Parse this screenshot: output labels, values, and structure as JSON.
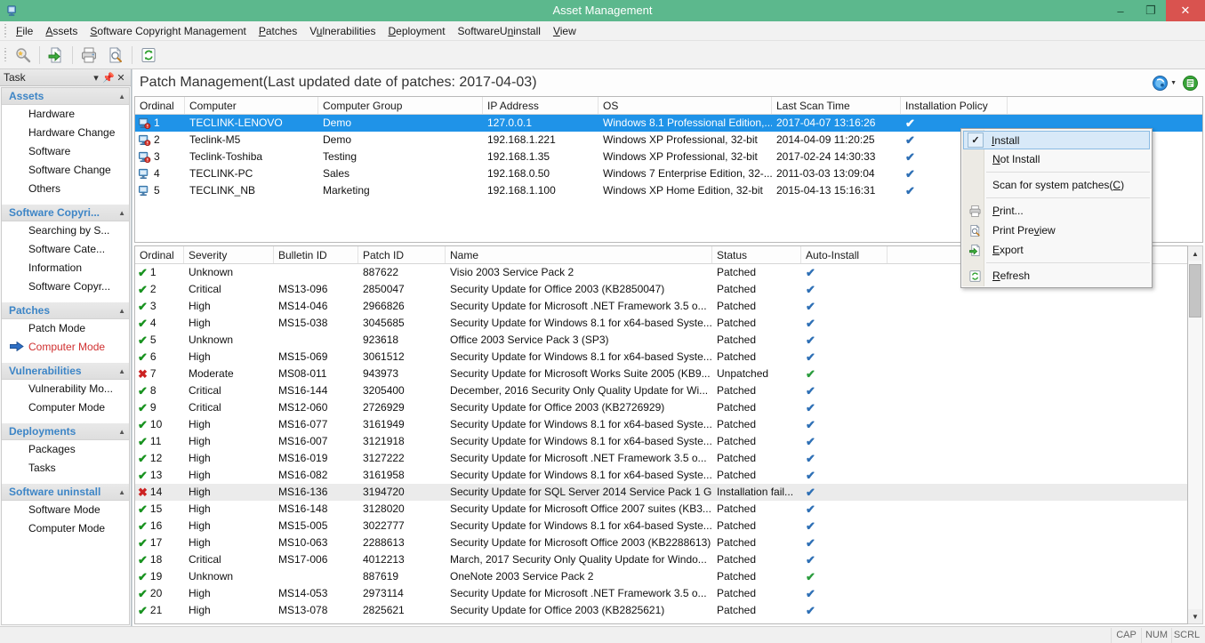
{
  "window": {
    "title": "Asset Management",
    "app_icon": "computer-icon",
    "minimize": "–",
    "maximize": "❐",
    "close": "✕"
  },
  "menubar": {
    "items": [
      {
        "label": "File",
        "accel": "F"
      },
      {
        "label": "Assets",
        "accel": "A"
      },
      {
        "label": "Software Copyright Management",
        "accel": "S"
      },
      {
        "label": "Patches",
        "accel": "P"
      },
      {
        "label": "Vulnerabilities",
        "accel": "u"
      },
      {
        "label": "Deployment",
        "accel": "D"
      },
      {
        "label": "SoftwareUninstall",
        "accel": "n"
      },
      {
        "label": "View",
        "accel": "V"
      }
    ]
  },
  "toolbar": {
    "buttons": [
      {
        "name": "scan-icon",
        "title": "Scan"
      },
      {
        "name": "export-icon",
        "title": "Export"
      },
      {
        "name": "print-icon",
        "title": "Print"
      },
      {
        "name": "print-preview-icon",
        "title": "Print Preview"
      },
      {
        "name": "refresh-icon",
        "title": "Refresh"
      }
    ]
  },
  "sidebar": {
    "header": "Task",
    "groups": [
      {
        "title": "Assets",
        "items": [
          {
            "label": "Hardware",
            "active": false
          },
          {
            "label": "Hardware Change",
            "active": false
          },
          {
            "label": "Software",
            "active": false
          },
          {
            "label": "Software Change",
            "active": false
          },
          {
            "label": "Others",
            "active": false
          }
        ]
      },
      {
        "title": "Software Copyri...",
        "items": [
          {
            "label": "Searching by S...",
            "active": false
          },
          {
            "label": "Software Cate...",
            "active": false
          },
          {
            "label": "Information",
            "active": false
          },
          {
            "label": "Software Copyr...",
            "active": false
          }
        ]
      },
      {
        "title": "Patches",
        "items": [
          {
            "label": "Patch Mode",
            "active": false
          },
          {
            "label": "Computer Mode",
            "active": true
          }
        ]
      },
      {
        "title": "Vulnerabilities",
        "items": [
          {
            "label": "Vulnerability Mo...",
            "active": false
          },
          {
            "label": "Computer Mode",
            "active": false
          }
        ]
      },
      {
        "title": "Deployments",
        "items": [
          {
            "label": "Packages",
            "active": false
          },
          {
            "label": "Tasks",
            "active": false
          }
        ]
      },
      {
        "title": "Software uninstall",
        "items": [
          {
            "label": "Software Mode",
            "active": false
          },
          {
            "label": "Computer Mode",
            "active": false
          }
        ]
      }
    ]
  },
  "page": {
    "title": "Patch Management(Last updated date of patches: 2017-04-03)"
  },
  "computers_grid": {
    "columns": [
      "Ordinal",
      "Computer",
      "Computer Group",
      "IP Address",
      "OS",
      "Last Scan Time",
      "Installation Policy"
    ],
    "rows": [
      {
        "ordinal": "1",
        "computer": "TECLINK-LENOVO",
        "group": "Demo",
        "ip": "127.0.0.1",
        "os": "Windows 8.1 Professional Edition,...",
        "scan": "2017-04-07 13:16:26",
        "policy": "✔",
        "selected": true,
        "warn": true
      },
      {
        "ordinal": "2",
        "computer": "Teclink-M5",
        "group": "Demo",
        "ip": "192.168.1.221",
        "os": "Windows XP Professional, 32-bit",
        "scan": "2014-04-09 11:20:25",
        "policy": "✔",
        "selected": false,
        "warn": true
      },
      {
        "ordinal": "3",
        "computer": "Teclink-Toshiba",
        "group": "Testing",
        "ip": "192.168.1.35",
        "os": "Windows XP Professional, 32-bit",
        "scan": "2017-02-24 14:30:33",
        "policy": "✔",
        "selected": false,
        "warn": true
      },
      {
        "ordinal": "4",
        "computer": "TECLINK-PC",
        "group": "Sales",
        "ip": "192.168.0.50",
        "os": "Windows 7 Enterprise Edition, 32-...",
        "scan": "2011-03-03 13:09:04",
        "policy": "✔",
        "selected": false,
        "warn": false
      },
      {
        "ordinal": "5",
        "computer": "TECLINK_NB",
        "group": "Marketing",
        "ip": "192.168.1.100",
        "os": "Windows XP Home Edition, 32-bit",
        "scan": "2015-04-13 15:16:31",
        "policy": "✔",
        "selected": false,
        "warn": false
      }
    ]
  },
  "patches_grid": {
    "columns": [
      "Ordinal",
      "Severity",
      "Bulletin ID",
      "Patch ID",
      "Name",
      "Status",
      "Auto-Install"
    ],
    "rows": [
      {
        "ordinal": "1",
        "ok": true,
        "severity": "Unknown",
        "bulletin": "",
        "patch_id": "887622",
        "name": "Visio 2003 Service Pack 2",
        "status": "Patched",
        "auto": "✔",
        "auto_green": false,
        "highlight": false
      },
      {
        "ordinal": "2",
        "ok": true,
        "severity": "Critical",
        "bulletin": "MS13-096",
        "patch_id": "2850047",
        "name": "Security Update for Office 2003 (KB2850047)",
        "status": "Patched",
        "auto": "✔",
        "auto_green": false,
        "highlight": false
      },
      {
        "ordinal": "3",
        "ok": true,
        "severity": "High",
        "bulletin": "MS14-046",
        "patch_id": "2966826",
        "name": "Security Update for Microsoft .NET Framework 3.5 o...",
        "status": "Patched",
        "auto": "✔",
        "auto_green": false,
        "highlight": false
      },
      {
        "ordinal": "4",
        "ok": true,
        "severity": "High",
        "bulletin": "MS15-038",
        "patch_id": "3045685",
        "name": "Security Update for Windows 8.1 for x64-based Syste...",
        "status": "Patched",
        "auto": "✔",
        "auto_green": false,
        "highlight": false
      },
      {
        "ordinal": "5",
        "ok": true,
        "severity": "Unknown",
        "bulletin": "",
        "patch_id": "923618",
        "name": "Office 2003 Service Pack 3 (SP3)",
        "status": "Patched",
        "auto": "✔",
        "auto_green": false,
        "highlight": false
      },
      {
        "ordinal": "6",
        "ok": true,
        "severity": "High",
        "bulletin": "MS15-069",
        "patch_id": "3061512",
        "name": "Security Update for Windows 8.1 for x64-based Syste...",
        "status": "Patched",
        "auto": "✔",
        "auto_green": false,
        "highlight": false
      },
      {
        "ordinal": "7",
        "ok": false,
        "severity": "Moderate",
        "bulletin": "MS08-011",
        "patch_id": "943973",
        "name": "Security Update for Microsoft Works Suite 2005 (KB9...",
        "status": "Unpatched",
        "auto": "✔",
        "auto_green": true,
        "highlight": false
      },
      {
        "ordinal": "8",
        "ok": true,
        "severity": "Critical",
        "bulletin": "MS16-144",
        "patch_id": "3205400",
        "name": "December, 2016 Security Only Quality Update for Wi...",
        "status": "Patched",
        "auto": "✔",
        "auto_green": false,
        "highlight": false
      },
      {
        "ordinal": "9",
        "ok": true,
        "severity": "Critical",
        "bulletin": "MS12-060",
        "patch_id": "2726929",
        "name": "Security Update for Office 2003 (KB2726929)",
        "status": "Patched",
        "auto": "✔",
        "auto_green": false,
        "highlight": false
      },
      {
        "ordinal": "10",
        "ok": true,
        "severity": "High",
        "bulletin": "MS16-077",
        "patch_id": "3161949",
        "name": "Security Update for Windows 8.1 for x64-based Syste...",
        "status": "Patched",
        "auto": "✔",
        "auto_green": false,
        "highlight": false
      },
      {
        "ordinal": "11",
        "ok": true,
        "severity": "High",
        "bulletin": "MS16-007",
        "patch_id": "3121918",
        "name": "Security Update for Windows 8.1 for x64-based Syste...",
        "status": "Patched",
        "auto": "✔",
        "auto_green": false,
        "highlight": false
      },
      {
        "ordinal": "12",
        "ok": true,
        "severity": "High",
        "bulletin": "MS16-019",
        "patch_id": "3127222",
        "name": "Security Update for Microsoft .NET Framework 3.5 o...",
        "status": "Patched",
        "auto": "✔",
        "auto_green": false,
        "highlight": false
      },
      {
        "ordinal": "13",
        "ok": true,
        "severity": "High",
        "bulletin": "MS16-082",
        "patch_id": "3161958",
        "name": "Security Update for Windows 8.1 for x64-based Syste...",
        "status": "Patched",
        "auto": "✔",
        "auto_green": false,
        "highlight": false
      },
      {
        "ordinal": "14",
        "ok": false,
        "severity": "High",
        "bulletin": "MS16-136",
        "patch_id": "3194720",
        "name": "Security Update for SQL Server 2014 Service Pack 1 G...",
        "status": "Installation fail...",
        "auto": "✔",
        "auto_green": false,
        "highlight": true
      },
      {
        "ordinal": "15",
        "ok": true,
        "severity": "High",
        "bulletin": "MS16-148",
        "patch_id": "3128020",
        "name": "Security Update for Microsoft Office 2007 suites (KB3...",
        "status": "Patched",
        "auto": "✔",
        "auto_green": false,
        "highlight": false
      },
      {
        "ordinal": "16",
        "ok": true,
        "severity": "High",
        "bulletin": "MS15-005",
        "patch_id": "3022777",
        "name": "Security Update for Windows 8.1 for x64-based Syste...",
        "status": "Patched",
        "auto": "✔",
        "auto_green": false,
        "highlight": false
      },
      {
        "ordinal": "17",
        "ok": true,
        "severity": "High",
        "bulletin": "MS10-063",
        "patch_id": "2288613",
        "name": "Security Update for Microsoft Office 2003 (KB2288613)",
        "status": "Patched",
        "auto": "✔",
        "auto_green": false,
        "highlight": false
      },
      {
        "ordinal": "18",
        "ok": true,
        "severity": "Critical",
        "bulletin": "MS17-006",
        "patch_id": "4012213",
        "name": "March, 2017 Security Only Quality Update for Windo...",
        "status": "Patched",
        "auto": "✔",
        "auto_green": false,
        "highlight": false
      },
      {
        "ordinal": "19",
        "ok": true,
        "severity": "Unknown",
        "bulletin": "",
        "patch_id": "887619",
        "name": "OneNote 2003 Service Pack 2",
        "status": "Patched",
        "auto": "✔",
        "auto_green": true,
        "highlight": false
      },
      {
        "ordinal": "20",
        "ok": true,
        "severity": "High",
        "bulletin": "MS14-053",
        "patch_id": "2973114",
        "name": "Security Update for Microsoft .NET Framework 3.5 o...",
        "status": "Patched",
        "auto": "✔",
        "auto_green": false,
        "highlight": false
      },
      {
        "ordinal": "21",
        "ok": true,
        "severity": "High",
        "bulletin": "MS13-078",
        "patch_id": "2825621",
        "name": "Security Update for Office 2003 (KB2825621)",
        "status": "Patched",
        "auto": "✔",
        "auto_green": false,
        "highlight": false
      }
    ]
  },
  "context_menu": {
    "items": [
      {
        "label": "Install",
        "accel": "I",
        "icon": "check-icon",
        "checked": true,
        "selected": true
      },
      {
        "label": "Not Install",
        "accel": "N",
        "icon": "",
        "checked": false,
        "selected": false
      },
      {
        "separator": true
      },
      {
        "label": "Scan for system patches(C)",
        "accel": "C",
        "icon": "",
        "checked": false,
        "selected": false
      },
      {
        "separator": true
      },
      {
        "label": "Print...",
        "accel": "P",
        "icon": "print-icon",
        "checked": false,
        "selected": false
      },
      {
        "label": "Print Preview",
        "accel": "v",
        "icon": "print-preview-icon",
        "checked": false,
        "selected": false
      },
      {
        "label": "Export",
        "accel": "E",
        "icon": "export-icon",
        "checked": false,
        "selected": false
      },
      {
        "separator": true
      },
      {
        "label": "Refresh",
        "accel": "R",
        "icon": "refresh-icon",
        "checked": false,
        "selected": false
      }
    ]
  },
  "statusbar": {
    "cells": [
      "CAP",
      "NUM",
      "SCRL"
    ]
  },
  "colors": {
    "titlebar": "#5cb88d",
    "close": "#d9534f",
    "selection": "#1f93e8",
    "group_header_text": "#3d85c6",
    "active_link": "#d03030",
    "check_blue": "#2d6fb5",
    "check_green": "#2a9c3d",
    "cross_red": "#cc2222"
  }
}
